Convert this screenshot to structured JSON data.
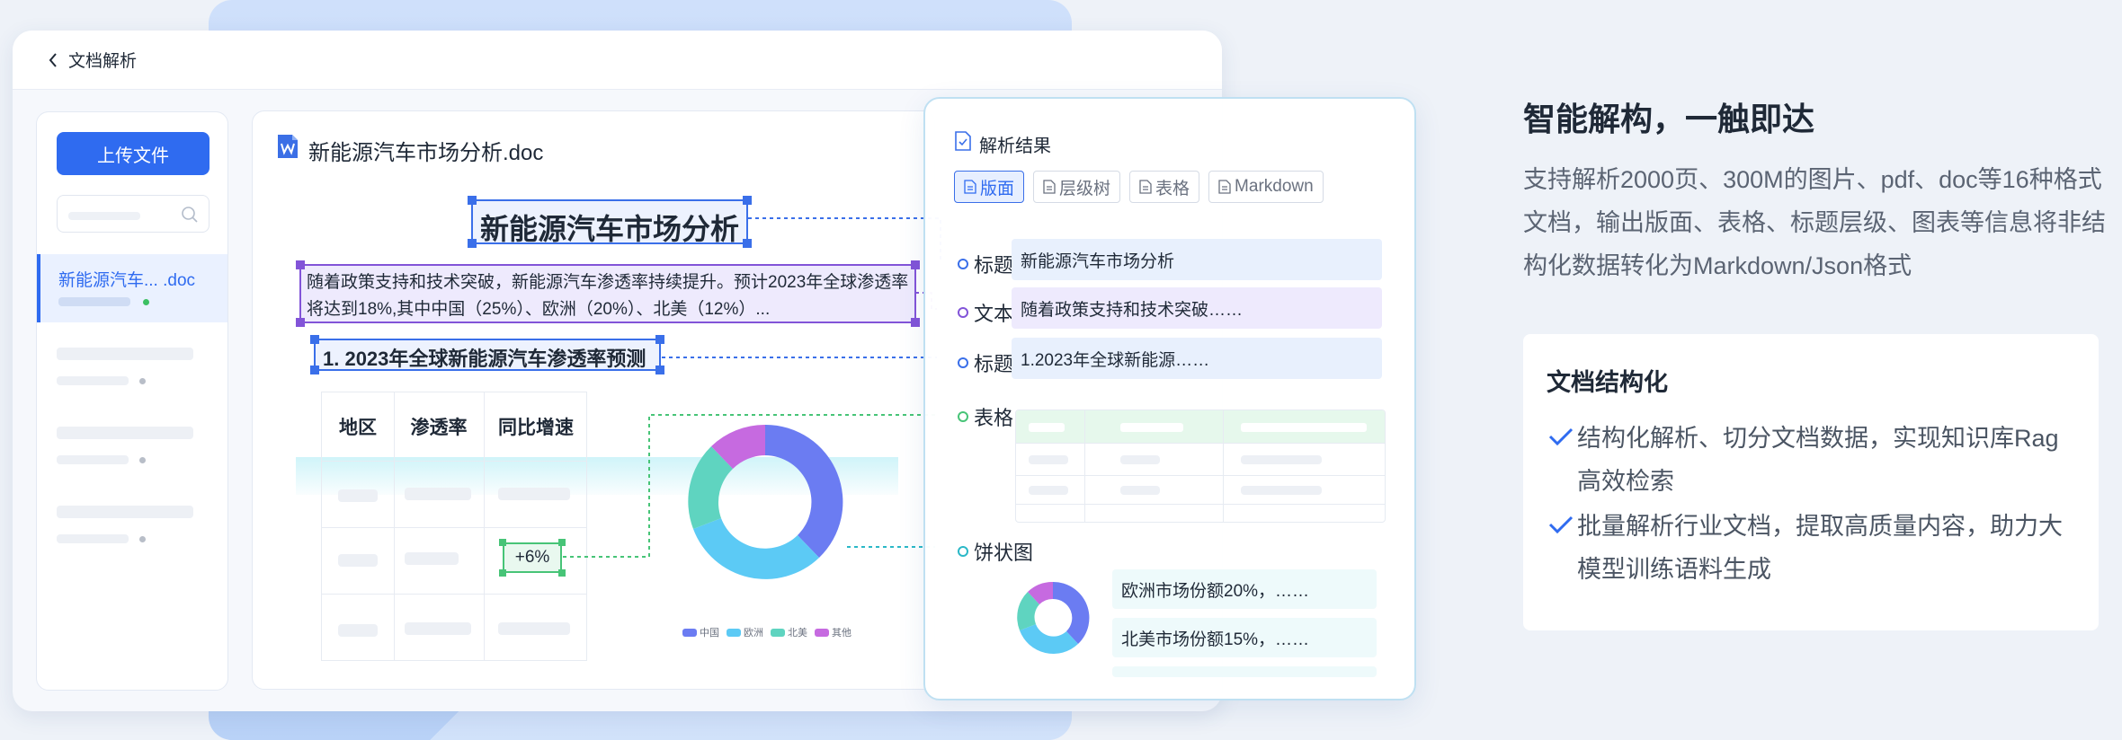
{
  "window": {
    "title": "文档解析"
  },
  "sidebar": {
    "upload_label": "上传文件",
    "active_file": "新能源汽车... .doc"
  },
  "document": {
    "file_name": "新能源汽车市场分析.doc",
    "title": "新能源汽车市场分析",
    "paragraph": "随着政策支持和技术突破，新能源汽车渗透率持续提升。预计2023年全球渗透率将达到18%,其中中国（25%）、欧洲（20%）、北美（12%）...",
    "subtitle": "1. 2023年全球新能源汽车渗透率预测",
    "table_headers": [
      "地区",
      "渗透率",
      "同比增速"
    ],
    "highlight_value": "+6%",
    "chart_legend": [
      {
        "label": "中国",
        "color": "#6b7cf2"
      },
      {
        "label": "欧洲",
        "color": "#5ccaf5"
      },
      {
        "label": "北美",
        "color": "#5fd4c0"
      },
      {
        "label": "其他",
        "color": "#c66ae0"
      }
    ]
  },
  "result": {
    "title": "解析结果",
    "tabs": [
      "版面",
      "层级树",
      "表格",
      "Markdown"
    ],
    "active_tab": "版面",
    "rows": [
      {
        "label": "标题",
        "value": "新能源汽车市场分析"
      },
      {
        "label": "文本",
        "value": "随着政策支持和技术突破……"
      },
      {
        "label": "标题",
        "value": "1.2023年全球新能源……"
      }
    ],
    "table_label": "表格",
    "pie_label": "饼状图",
    "pie_texts": [
      "欧洲市场份额20%，……",
      "北美市场份额15%，……"
    ]
  },
  "marketing": {
    "headline": "智能解构，一触即达",
    "description": "支持解析2000页、300M的图片、pdf、doc等16种格式文档，输出版面、表格、标题层级、图表等信息将非结构化数据转化为Markdown/Json格式",
    "feature_title": "文档结构化",
    "features": [
      "结构化解析、切分文档数据，实现知识库Rag高效检索",
      "批量解析行业文档，提取高质量内容，助力大模型训练语料生成"
    ]
  },
  "colors": {
    "accent": "#2f6bf0",
    "purple": "#8254d8",
    "green": "#47c477",
    "teal": "#5fd4c0"
  }
}
